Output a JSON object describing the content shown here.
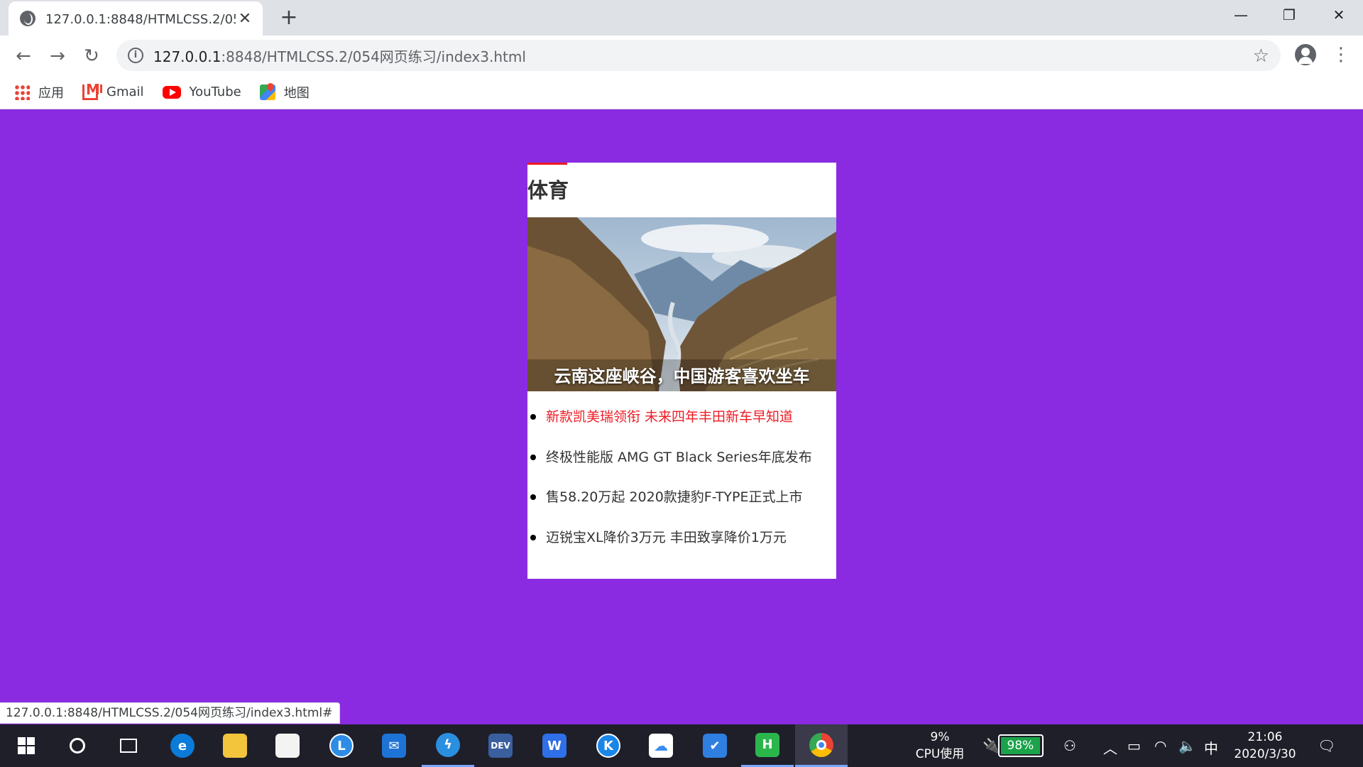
{
  "browser": {
    "tab_title": "127.0.0.1:8848/HTMLCSS.2/054网页练习/index3.html",
    "url_host": "127.0.0.1",
    "url_rest": ":8848/HTMLCSS.2/054网页练习/index3.html",
    "bookmarks": [
      {
        "label": "应用",
        "icon": "apps-icon"
      },
      {
        "label": "Gmail",
        "icon": "gmail-icon"
      },
      {
        "label": "YouTube",
        "icon": "youtube-icon"
      },
      {
        "label": "地图",
        "icon": "maps-icon"
      }
    ],
    "status_url": "127.0.0.1:8848/HTMLCSS.2/054网页练习/index3.html#"
  },
  "page": {
    "background": "#8a2be2",
    "card": {
      "title": "体育",
      "accent_color": "#ee1c25",
      "image_caption": "云南这座峡谷，中国游客喜欢坐车",
      "news": [
        {
          "text": "新款凯美瑞领衔 未来四年丰田新车早知道",
          "active": true
        },
        {
          "text": "终极性能版 AMG GT Black Series年底发布",
          "active": false
        },
        {
          "text": "售58.20万起 2020款捷豹F-TYPE正式上市",
          "active": false
        },
        {
          "text": "迈锐宝XL降价3万元 丰田致享降价1万元",
          "active": false
        }
      ]
    }
  },
  "taskbar": {
    "cpu_percent": "9%",
    "cpu_label": "CPU使用",
    "battery": "98%",
    "ime": "中",
    "time": "21:06",
    "date": "2020/3/30"
  }
}
